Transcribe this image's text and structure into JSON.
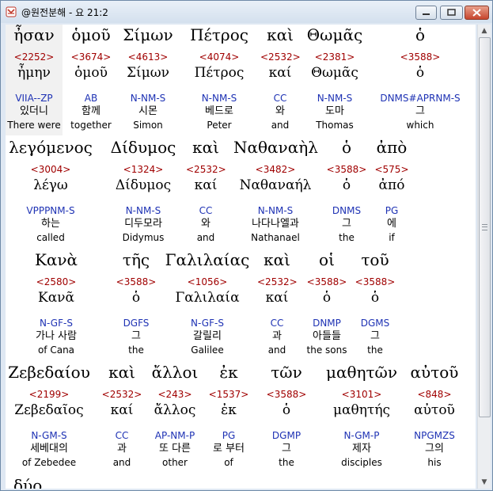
{
  "window": {
    "title": "@원전분해 - 요 21:2",
    "icon": "app-book-icon",
    "controls": [
      "minimize",
      "maximize",
      "close"
    ]
  },
  "rows": [
    {
      "words": [
        {
          "greek": "ἦσαν",
          "strong": "<2252>",
          "lemma": "ἦμην",
          "parse": "VIIA--ZP",
          "korean": "있더니",
          "english": "There were"
        },
        {
          "greek": "ὁμοῦ",
          "strong": "<3674>",
          "lemma": "ὁμοῦ",
          "parse": "AB",
          "korean": "함께",
          "english": "together"
        },
        {
          "greek": "Σίμων",
          "strong": "<4613>",
          "lemma": "Σίμων",
          "parse": "N-NM-S",
          "korean": "시몬",
          "english": "Simon"
        },
        {
          "greek": "Πέτρος",
          "strong": "<4074>",
          "lemma": "Πέτρος",
          "parse": "N-NM-S",
          "korean": "베드로",
          "english": "Peter"
        },
        {
          "greek": "καὶ",
          "strong": "<2532>",
          "lemma": "καί",
          "parse": "CC",
          "korean": "와",
          "english": "and"
        },
        {
          "greek": "Θωμᾶς",
          "strong": "<2381>",
          "lemma": "Θωμᾶς",
          "parse": "N-NM-S",
          "korean": "도마",
          "english": "Thomas"
        },
        {
          "greek": "ὁ",
          "strong": "<3588>",
          "lemma": "ὁ",
          "parse": "DNMS#APRNM-S",
          "korean": "그",
          "english": "which"
        }
      ]
    },
    {
      "words": [
        {
          "greek": "λεγόμενος",
          "strong": "<3004>",
          "lemma": "λέγω",
          "parse": "VPPPNM-S",
          "korean": "하는",
          "english": "called"
        },
        {
          "greek": "Δίδυμος",
          "strong": "<1324>",
          "lemma": "Δίδυμος",
          "parse": "N-NM-S",
          "korean": "디두모라",
          "english": "Didymus"
        },
        {
          "greek": "καὶ",
          "strong": "<2532>",
          "lemma": "καί",
          "parse": "CC",
          "korean": "와",
          "english": "and"
        },
        {
          "greek": "Ναθαναὴλ",
          "strong": "<3482>",
          "lemma": "Ναθαναήλ",
          "parse": "N-NM-S",
          "korean": "나다나엘과",
          "english": "Nathanael"
        },
        {
          "greek": "ὁ",
          "strong": "<3588>",
          "lemma": "ὁ",
          "parse": "DNMS",
          "korean": "그",
          "english": "the"
        },
        {
          "greek": "ἀπὸ",
          "strong": "<575>",
          "lemma": "ἀπό",
          "parse": "PG",
          "korean": "에",
          "english": "if"
        }
      ]
    },
    {
      "words": [
        {
          "greek": "Κανὰ",
          "strong": "<2580>",
          "lemma": "Κανᾶ",
          "parse": "N-GF-S",
          "korean": "가나 사람",
          "english": "of Cana"
        },
        {
          "greek": "τῆς",
          "strong": "<3588>",
          "lemma": "ὁ",
          "parse": "DGFS",
          "korean": "그",
          "english": "the"
        },
        {
          "greek": "Γαλιλαίας",
          "strong": "<1056>",
          "lemma": "Γαλιλαία",
          "parse": "N-GF-S",
          "korean": "갈릴리",
          "english": "Galilee"
        },
        {
          "greek": "καὶ",
          "strong": "<2532>",
          "lemma": "καί",
          "parse": "CC",
          "korean": "과",
          "english": "and"
        },
        {
          "greek": "οἱ",
          "strong": "<3588>",
          "lemma": "ὁ",
          "parse": "DNMP",
          "korean": "아들들",
          "english": "the sons"
        },
        {
          "greek": "τοῦ",
          "strong": "<3588>",
          "lemma": "ὁ",
          "parse": "DGMS",
          "korean": "그",
          "english": "the"
        }
      ]
    },
    {
      "words": [
        {
          "greek": "Ζεβεδαίου",
          "strong": "<2199>",
          "lemma": "Ζεβεδαῖος",
          "parse": "N-GM-S",
          "korean": "세베대의",
          "english": "of Zebedee"
        },
        {
          "greek": "καὶ",
          "strong": "<2532>",
          "lemma": "καί",
          "parse": "CC",
          "korean": "과",
          "english": "and"
        },
        {
          "greek": "ἄλλοι",
          "strong": "<243>",
          "lemma": "ἄλλος",
          "parse": "AP-NM-P",
          "korean": "또 다른",
          "english": "other"
        },
        {
          "greek": "ἐκ",
          "strong": "<1537>",
          "lemma": "ἐκ",
          "parse": "PG",
          "korean": "로 부터",
          "english": "of"
        },
        {
          "greek": "τῶν",
          "strong": "<3588>",
          "lemma": "ὁ",
          "parse": "DGMP",
          "korean": "그",
          "english": "the"
        },
        {
          "greek": "μαθητῶν",
          "strong": "<3101>",
          "lemma": "μαθητής",
          "parse": "N-GM-P",
          "korean": "제자",
          "english": "disciples"
        },
        {
          "greek": "αὐτοῦ",
          "strong": "<848>",
          "lemma": "αὐτοῦ",
          "parse": "NPGMZS",
          "korean": "그의",
          "english": "his"
        }
      ]
    }
  ],
  "partial_next": "δύο",
  "colors": {
    "strong": "#a00000",
    "parse": "#1e32b4",
    "highlight": "#f1f1f1"
  }
}
